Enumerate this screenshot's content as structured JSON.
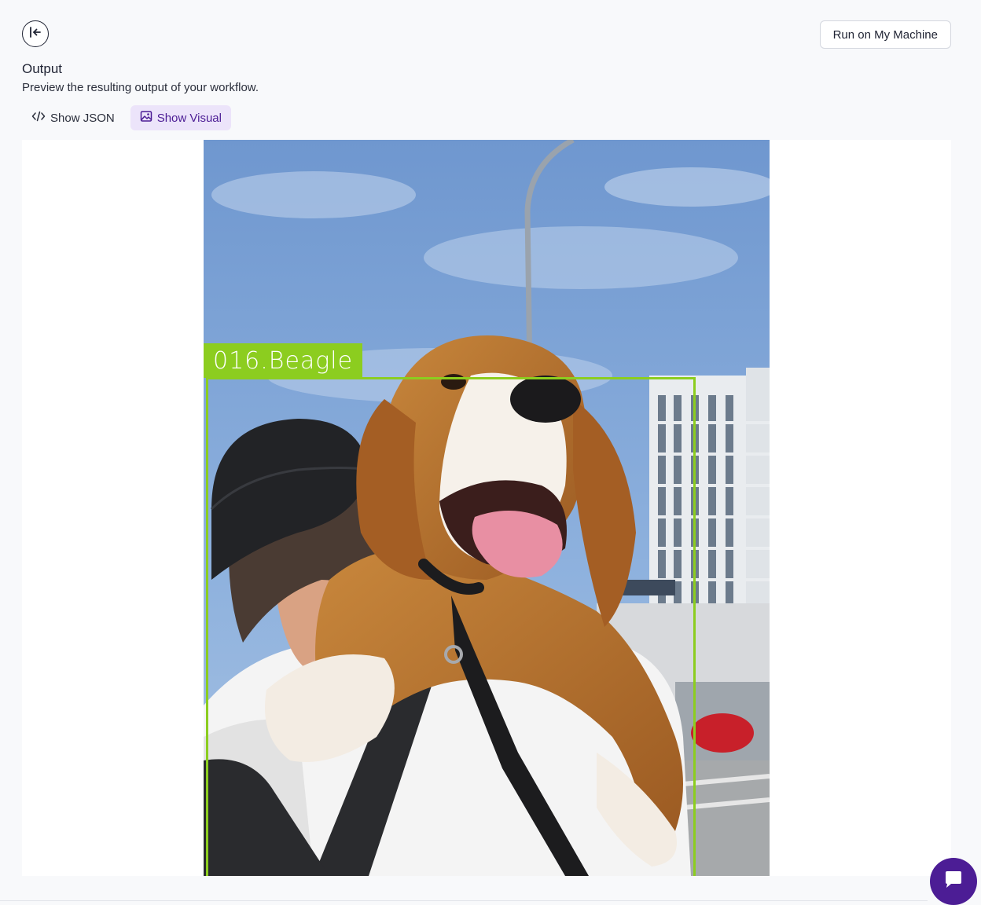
{
  "header": {
    "run_button_label": "Run on My Machine"
  },
  "output": {
    "title": "Output",
    "subtitle": "Preview the resulting output of your workflow."
  },
  "tabs": [
    {
      "label": "Show JSON",
      "icon": "code-icon",
      "active": false
    },
    {
      "label": "Show Visual",
      "icon": "image-icon",
      "active": true
    }
  ],
  "visual": {
    "detections": [
      {
        "label": "016.Beagle",
        "color": "#8ccd1f"
      }
    ]
  },
  "colors": {
    "accent": "#4c1d95",
    "active_tab_bg": "#ece4fa",
    "bbox": "#8ccd1f"
  }
}
